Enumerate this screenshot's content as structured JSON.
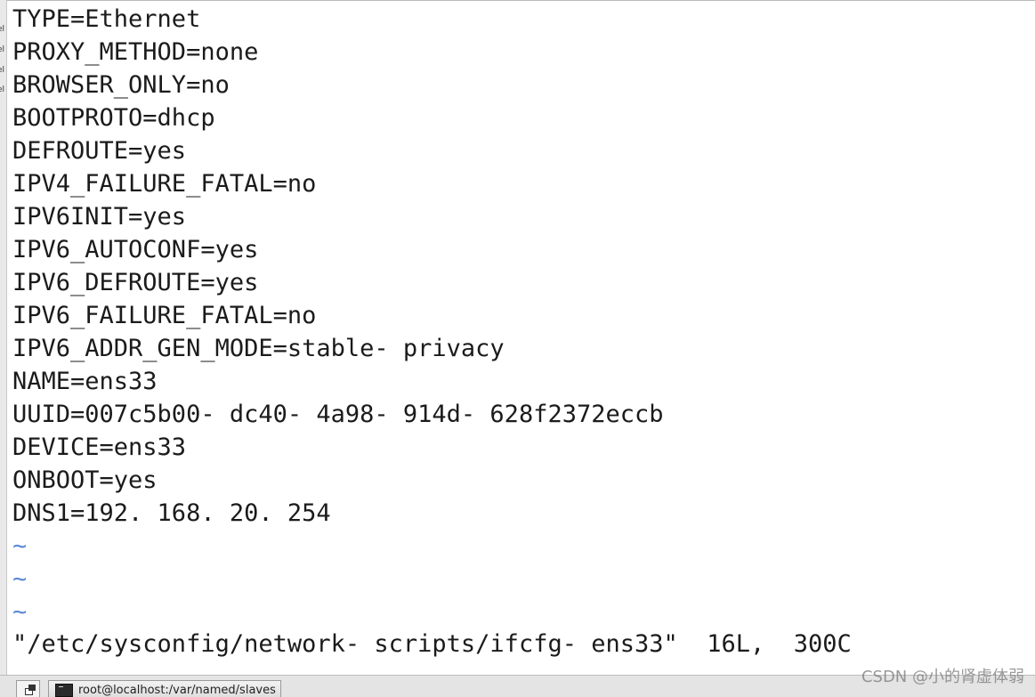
{
  "editor": {
    "lines": [
      "TYPE=Ethernet",
      "PROXY_METHOD=none",
      "BROWSER_ONLY=no",
      "BOOTPROTO=dhcp",
      "DEFROUTE=yes",
      "IPV4_FAILURE_FATAL=no",
      "IPV6INIT=yes",
      "IPV6_AUTOCONF=yes",
      "IPV6_DEFROUTE=yes",
      "IPV6_FAILURE_FATAL=no",
      "IPV6_ADDR_GEN_MODE=stable- privacy",
      "NAME=ens33",
      "UUID=007c5b00- dc40- 4a98- 914d- 628f2372eccb",
      "DEVICE=ens33",
      "ONBOOT=yes",
      "DNS1=192. 168. 20. 254"
    ],
    "tilde_lines": [
      "~",
      "~",
      "~"
    ],
    "status_line": "\"/etc/sysconfig/network- scripts/ifcfg- ens33\"  16L,  300C"
  },
  "taskbar": {
    "window_title": "root@localhost:/var/named/slaves"
  },
  "watermark": "CSDN @小的肾虚体弱",
  "colors": {
    "background": "#ffffff",
    "text": "#1b1b1b",
    "tilde": "#5b8ad6",
    "taskbar": "#e4e4e4"
  },
  "icons": {
    "show_desktop": "show-desktop-icon",
    "terminal": "terminal-icon"
  }
}
